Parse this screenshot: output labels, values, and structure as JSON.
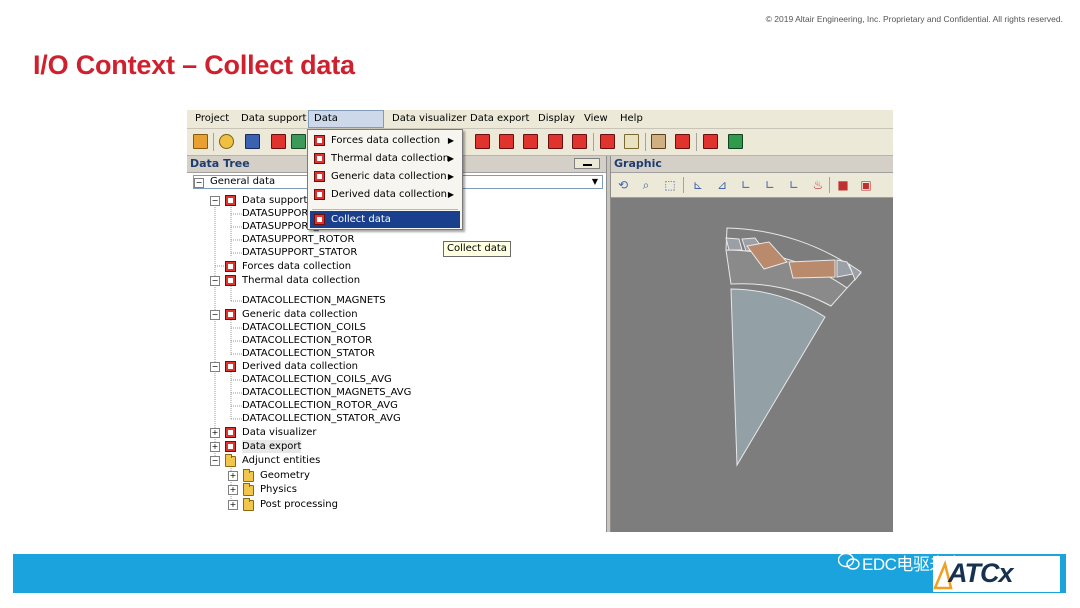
{
  "copyright": "© 2019 Altair Engineering, Inc. Proprietary and Confidential. All rights reserved.",
  "slide_title": "I/O Context – Collect data",
  "menubar": {
    "items": [
      "Project",
      "Data support",
      "Data collection",
      "Data visualizer",
      "Data export",
      "Display",
      "View",
      "Help"
    ],
    "active": "Data collection"
  },
  "tree_panel": {
    "title": "Data Tree",
    "combo_value": "General data",
    "combo_toggle": "−",
    "items": [
      {
        "label": "Data support",
        "toggle": "−"
      },
      {
        "label": "DATASUPPORT_COILS"
      },
      {
        "label": "DATASUPPORT_MAGNETS"
      },
      {
        "label": "DATASUPPORT_ROTOR"
      },
      {
        "label": "DATASUPPORT_STATOR"
      },
      {
        "label": "Forces data collection"
      },
      {
        "label": "Thermal data collection",
        "toggle": "−"
      },
      {
        "label": "DATACOLLECTION_MAGNETS"
      },
      {
        "label": "Generic data collection",
        "toggle": "−"
      },
      {
        "label": "DATACOLLECTION_COILS"
      },
      {
        "label": "DATACOLLECTION_ROTOR"
      },
      {
        "label": "DATACOLLECTION_STATOR"
      },
      {
        "label": "Derived data collection",
        "toggle": "−"
      },
      {
        "label": "DATACOLLECTION_COILS_AVG"
      },
      {
        "label": "DATACOLLECTION_MAGNETS_AVG"
      },
      {
        "label": "DATACOLLECTION_ROTOR_AVG"
      },
      {
        "label": "DATACOLLECTION_STATOR_AVG"
      },
      {
        "label": "Data visualizer",
        "toggle": "+"
      },
      {
        "label": "Data export",
        "toggle": "+"
      },
      {
        "label": "Adjunct entities",
        "toggle": "−"
      },
      {
        "label": "Geometry",
        "toggle": "+"
      },
      {
        "label": "Physics",
        "toggle": "+"
      },
      {
        "label": "Post processing",
        "toggle": "+"
      }
    ]
  },
  "graphic_panel": {
    "title": "Graphic",
    "toolbar_icons": [
      "rotate-icon",
      "zoom-icon",
      "zoom-region-icon",
      "view-x-icon",
      "view-y-icon",
      "view-z-icon",
      "view-xy-icon",
      "view-xz-icon",
      "fire-icon",
      "display-icon",
      "printer-icon"
    ]
  },
  "dropdown": {
    "items": [
      {
        "label": "Forces data collection",
        "submenu": "▶"
      },
      {
        "label": "Thermal data collection",
        "submenu": "▶"
      },
      {
        "label": "Generic data collection",
        "submenu": "▶"
      },
      {
        "label": "Derived data collection",
        "submenu": "▶"
      },
      {
        "label": "Collect data",
        "submenu": ""
      }
    ],
    "highlighted": "Collect data"
  },
  "tooltip": "Collect data",
  "footer": {
    "watermark": "EDC电驱未来",
    "logo": "ATCx"
  },
  "colors": {
    "title_red": "#d0202e",
    "footer_blue": "#1aa3dc",
    "menu_highlight": "#1a3f8c",
    "viewport_gray": "#7d7d7d"
  }
}
